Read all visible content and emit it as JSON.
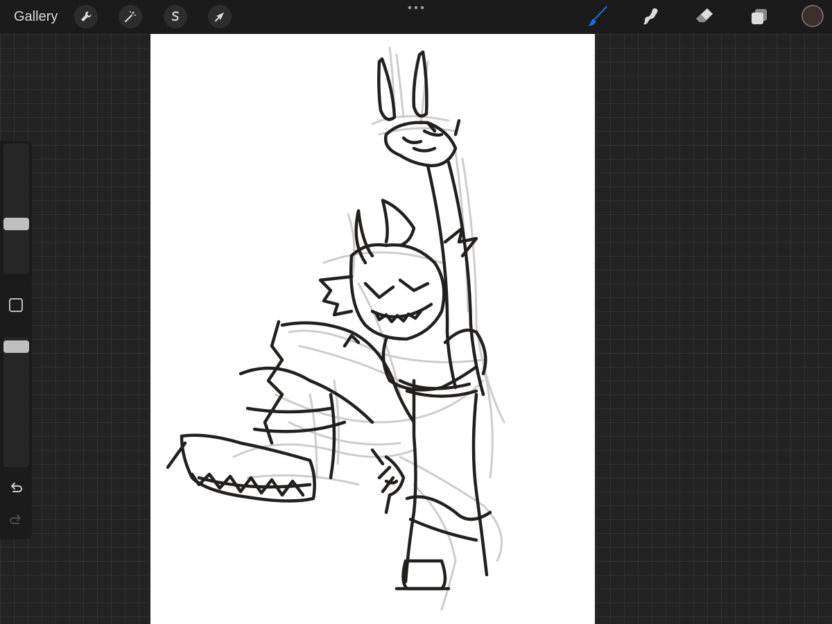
{
  "topbar": {
    "gallery_label": "Gallery",
    "left_tools": [
      {
        "name": "actions",
        "icon": "wrench-icon"
      },
      {
        "name": "adjustments",
        "icon": "magic-wand-icon"
      },
      {
        "name": "selection",
        "icon": "selection-s-icon"
      },
      {
        "name": "transform",
        "icon": "arrow-cursor-icon"
      }
    ],
    "more_icon": "more-dots-icon",
    "right_tools": [
      {
        "name": "brush",
        "icon": "brush-icon",
        "active": true
      },
      {
        "name": "smudge",
        "icon": "smudge-icon",
        "active": false
      },
      {
        "name": "eraser",
        "icon": "eraser-icon",
        "active": false
      },
      {
        "name": "layers",
        "icon": "layers-icon",
        "active": false
      }
    ],
    "current_color": "#3b2f2b"
  },
  "sidebar": {
    "brush_size": 0.37,
    "brush_opacity": 0.97,
    "modify_icon": "square-icon",
    "undo_icon": "undo-icon",
    "redo_icon": "redo-icon"
  },
  "colors": {
    "accent_active": "#1a6fe8",
    "toolbar_bg": "#1b1b1b",
    "workspace_bg": "#232323",
    "canvas_bg": "#ffffff",
    "ink": "#231f1d",
    "sketch_gray": "#cccccc"
  }
}
